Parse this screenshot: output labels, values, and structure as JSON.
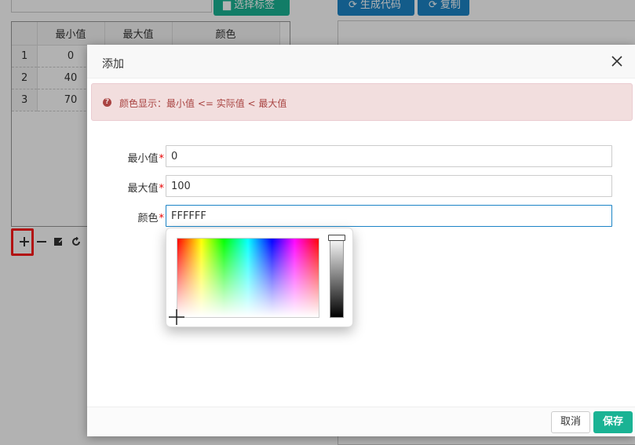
{
  "toolbar": {
    "select_tag_label": "选择标签",
    "generate_code_label": "生成代码",
    "copy_label": "复制"
  },
  "grid": {
    "headers": [
      "最小值",
      "最大值",
      "颜色"
    ],
    "rows": [
      {
        "index": "1",
        "min": "0"
      },
      {
        "index": "2",
        "min": "40"
      },
      {
        "index": "3",
        "min": "70"
      }
    ]
  },
  "grid_toolbar": {
    "icons": [
      "plus-icon",
      "minus-icon",
      "edit-icon",
      "refresh-icon"
    ]
  },
  "dialog": {
    "title": "添加",
    "alert_text": "颜色显示：最小值 <= 实际值 < 最大值",
    "fields": {
      "min_label": "最小值",
      "min_value": "0",
      "max_label": "最大值",
      "max_value": "100",
      "color_label": "颜色",
      "color_value": "FFFFFF",
      "required_mark": "*"
    },
    "cancel_label": "取消",
    "save_label": "保存"
  },
  "colors": {
    "primary_green": "#1ab394",
    "primary_blue": "#1c84c6",
    "alert_bg": "#f2dede",
    "alert_text": "#a94442",
    "required": "#e60000",
    "highlight_red": "#ff1a1a"
  }
}
